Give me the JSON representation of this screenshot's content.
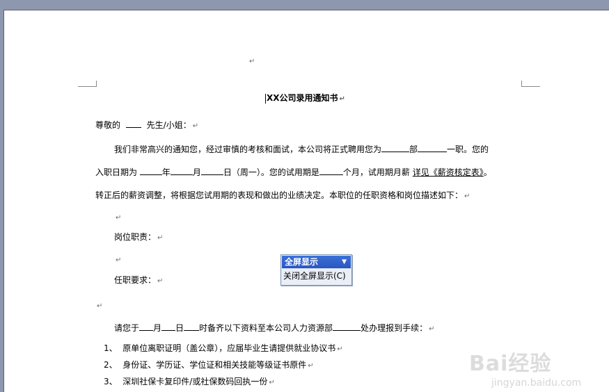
{
  "document": {
    "title": "XX公司录用通知书",
    "greeting_prefix": "尊敬的",
    "greeting_suffix": "先生/小姐：",
    "para1_line1_a": "我们非常高兴的通知您，经过审慎的考核和面试，本公司将正式聘用您为",
    "para1_line1_b": "部",
    "para1_line1_c": "一职。您的",
    "para1_line2_a": "入职日期为",
    "para1_line2_year": "年",
    "para1_line2_month": "月",
    "para1_line2_day": "日（周一）。您的试用期是",
    "para1_line2_b": "个月，试用期月薪",
    "para1_line2_link": "详见《薪资核定表》",
    "para1_line2_end": "。",
    "para1_line3": "转正后的薪资调整，将根据您试用期的表现和做出的业绩决定。本职位的任职资格和岗位描述如下：",
    "duties_label": "岗位职责：",
    "requirements_label": "任职要求：",
    "instruction_a": "请您于",
    "instruction_month": "月",
    "instruction_day": "日",
    "instruction_b": "时备齐以下资料至本公司人力资源部",
    "instruction_c": "处办理报到手续：",
    "list": [
      {
        "num": "1、",
        "text": "原单位离职证明（盖公章），应届毕业生请提供就业协议书"
      },
      {
        "num": "2、",
        "text": "身份证、学历证、学位证和相关技能等级证书原件"
      },
      {
        "num": "3、",
        "text": "深圳社保卡复印件/或社保数码回执一份"
      }
    ],
    "paragraph_mark": "↵"
  },
  "fullscreen_toolbar": {
    "title": "全屏显示",
    "dropdown_glyph": "▼",
    "close_button": "关闭全屏显示(C)"
  },
  "watermark": {
    "text": "Bai经验",
    "sub": "jingyan.baidu.com"
  }
}
